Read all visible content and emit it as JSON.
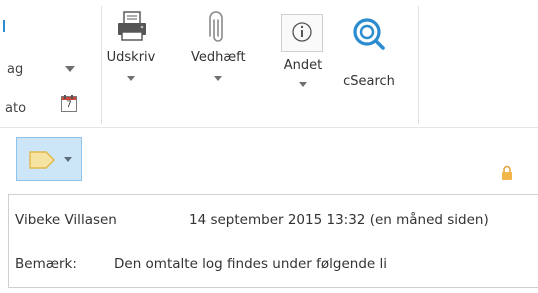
{
  "ribbon": {
    "partial_labels": {
      "row1": "ag",
      "row2": "ato"
    },
    "calendar_day": "7",
    "buttons": {
      "print": "Udskriv",
      "attach": "Vedhæft",
      "other": "Andet",
      "csearch": "cSearch"
    }
  },
  "message": {
    "sender": "Vibeke Villasen",
    "date": "14 september 2015 13:32 (en måned siden)",
    "note_label": "Bemærk:",
    "note_text": "Den omtalte log findes under følgende li"
  },
  "colors": {
    "accent_blue": "#2b8ccf",
    "highlight_bg": "#cde6f7",
    "highlight_border": "#8fc3ea",
    "tag_yellow": "#f4d36a",
    "lock_orange": "#e8a53a"
  }
}
